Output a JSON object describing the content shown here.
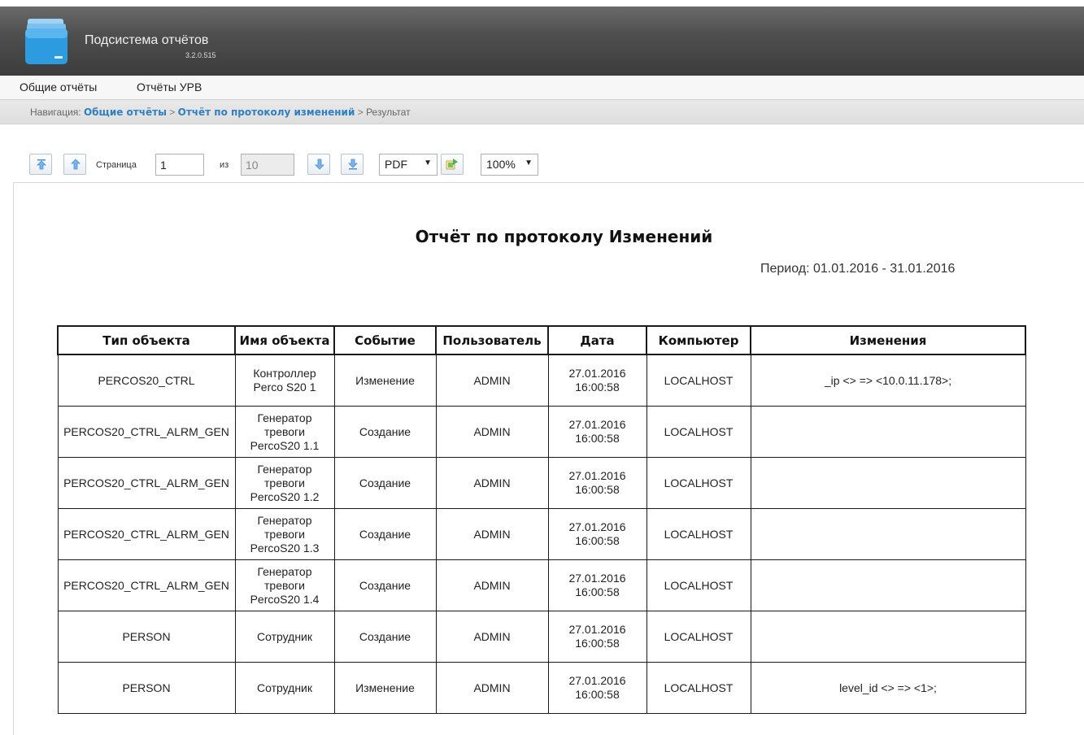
{
  "header": {
    "title": "Подсистема отчётов",
    "version": "3.2.0.515",
    "icon": "folder-icon"
  },
  "menu": {
    "items": [
      "Общие отчёты",
      "Отчёты УРВ"
    ]
  },
  "breadcrumb": {
    "prefix": "Навигация:",
    "links": [
      "Общие отчёты",
      "Отчёт по протоколу изменений"
    ],
    "current": "Результат",
    "separator": ">"
  },
  "toolbar": {
    "page_label": "Страница",
    "page_value": "1",
    "of_label": "из",
    "total_pages": "10",
    "format_value": "PDF",
    "zoom_value": "100%",
    "icons": [
      "first-page-icon",
      "prev-page-icon",
      "next-page-icon",
      "last-page-icon",
      "export-icon"
    ]
  },
  "report": {
    "title": "Отчёт по протоколу Изменений",
    "period": "Период: 01.01.2016 - 31.01.2016",
    "columns": [
      "Тип объекта",
      "Имя объекта",
      "Событие",
      "Пользователь",
      "Дата",
      "Компьютер",
      "Изменения"
    ],
    "rows": [
      {
        "type": "PERCOS20_CTRL",
        "name": "Контроллер\nPerco S20 1",
        "event": "Изменение",
        "user": "ADMIN",
        "date": "27.01.2016\n16:00:58",
        "computer": "LOCALHOST",
        "changes": "_ip <> => <10.0.11.178>;"
      },
      {
        "type": "PERCOS20_CTRL_ALRM_GEN",
        "name": "Генератор\nтревоги\nPercoS20 1.1",
        "event": "Создание",
        "user": "ADMIN",
        "date": "27.01.2016\n16:00:58",
        "computer": "LOCALHOST",
        "changes": ""
      },
      {
        "type": "PERCOS20_CTRL_ALRM_GEN",
        "name": "Генератор\nтревоги\nPercoS20 1.2",
        "event": "Создание",
        "user": "ADMIN",
        "date": "27.01.2016\n16:00:58",
        "computer": "LOCALHOST",
        "changes": ""
      },
      {
        "type": "PERCOS20_CTRL_ALRM_GEN",
        "name": "Генератор\nтревоги\nPercoS20 1.3",
        "event": "Создание",
        "user": "ADMIN",
        "date": "27.01.2016\n16:00:58",
        "computer": "LOCALHOST",
        "changes": ""
      },
      {
        "type": "PERCOS20_CTRL_ALRM_GEN",
        "name": "Генератор\nтревоги\nPercoS20 1.4",
        "event": "Создание",
        "user": "ADMIN",
        "date": "27.01.2016\n16:00:58",
        "computer": "LOCALHOST",
        "changes": ""
      },
      {
        "type": "PERSON",
        "name": "Сотрудник",
        "event": "Создание",
        "user": "ADMIN",
        "date": "27.01.2016\n16:00:58",
        "computer": "LOCALHOST",
        "changes": ""
      },
      {
        "type": "PERSON",
        "name": "Сотрудник",
        "event": "Изменение",
        "user": "ADMIN",
        "date": "27.01.2016\n16:00:58",
        "computer": "LOCALHOST",
        "changes": "level_id <> => <1>;"
      }
    ]
  }
}
